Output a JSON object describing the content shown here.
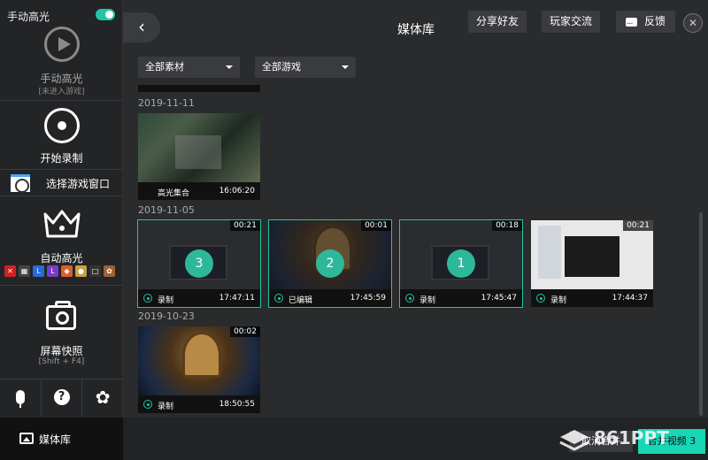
{
  "sidebar": {
    "toggle_label": "手动高光",
    "toggle_on": true,
    "manual_label": "手动高光",
    "manual_sub": "[未进入游戏]",
    "record_label": "开始录制",
    "select_window_label": "选择游戏窗口",
    "auto_label": "自动高光",
    "game_icons": [
      {
        "color": "#c22",
        "glyph": "✕"
      },
      {
        "color": "#444",
        "glyph": "▦"
      },
      {
        "color": "#2a6bd8",
        "glyph": "L"
      },
      {
        "color": "#7a3cc8",
        "glyph": "L"
      },
      {
        "color": "#d8602a",
        "glyph": "◆"
      },
      {
        "color": "#c8a040",
        "glyph": "●"
      },
      {
        "color": "#333",
        "glyph": "□"
      },
      {
        "color": "#a06030",
        "glyph": "✿"
      }
    ],
    "screenshot_label": "屏幕快照",
    "screenshot_shortcut": "[Shift + F4]",
    "library_label": "媒体库"
  },
  "header": {
    "title": "媒体库",
    "share_label": "分享好友",
    "community_label": "玩家交流",
    "feedback_label": "反馈"
  },
  "filters": {
    "material": "全部素材",
    "game": "全部游戏"
  },
  "groups": [
    {
      "date": "2019-11-11",
      "items": [
        {
          "kind": "lol",
          "name": "高光集合",
          "time": "16:06:20",
          "duration": "",
          "badge": "",
          "selected": false,
          "icon": false
        }
      ]
    },
    {
      "date": "2019-11-05",
      "items": [
        {
          "kind": "ss",
          "name": "录制",
          "time": "17:47:11",
          "duration": "00:21",
          "badge": "3",
          "selected": true,
          "icon": true
        },
        {
          "kind": "hs",
          "name": "已编辑",
          "time": "17:45:59",
          "duration": "00:01",
          "badge": "2",
          "selected": true,
          "icon": true
        },
        {
          "kind": "ss",
          "name": "录制",
          "time": "17:45:47",
          "duration": "00:18",
          "badge": "1",
          "selected": true,
          "icon": true
        },
        {
          "kind": "desk",
          "name": "录制",
          "time": "17:44:37",
          "duration": "00:21",
          "badge": "",
          "selected": false,
          "icon": true
        }
      ]
    },
    {
      "date": "2019-10-23",
      "items": [
        {
          "kind": "hs",
          "name": "录制",
          "time": "18:50:55",
          "duration": "00:02",
          "badge": "",
          "selected": false,
          "icon": true
        }
      ]
    }
  ],
  "footer": {
    "cancel_label": "取消合并",
    "merge_label": "合并视频 3",
    "watermark": "861PPT"
  }
}
